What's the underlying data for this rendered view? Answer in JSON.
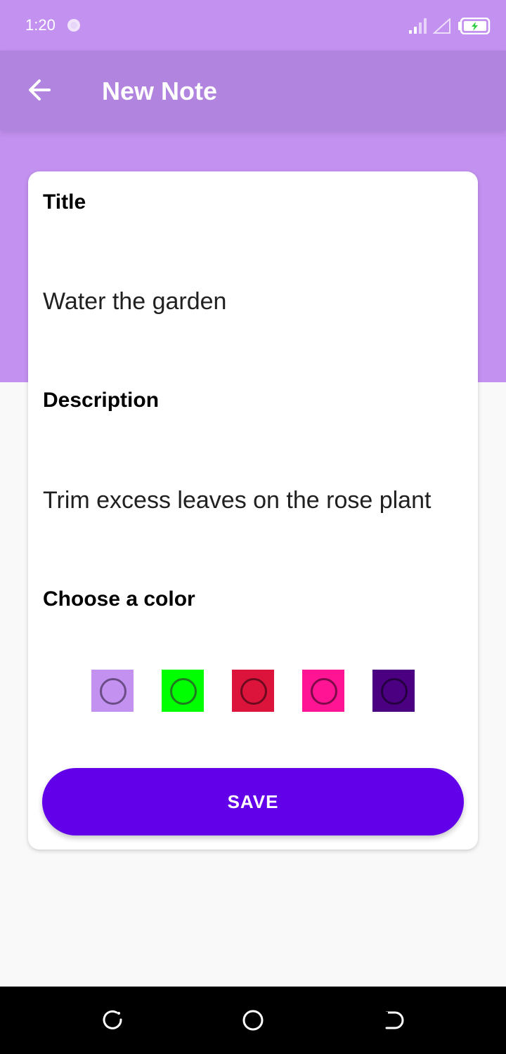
{
  "status_bar": {
    "time": "1:20",
    "icons": [
      "brightness-icon",
      "signal-icon",
      "no-sim-icon",
      "battery-charging-icon"
    ]
  },
  "app_bar": {
    "title": "New Note",
    "back_icon": "arrow-back-icon",
    "background": "#b084df"
  },
  "header_background": "#c391f0",
  "form": {
    "title_label": "Title",
    "title_value": "Water the garden",
    "description_label": "Description",
    "description_value": "Trim excess leaves on the rose plant",
    "color_label": "Choose a color",
    "colors": [
      {
        "name": "light-purple",
        "hex": "#c391f0",
        "ring": "#6b4d86"
      },
      {
        "name": "green",
        "hex": "#00ff00",
        "ring": "#1f7a1f"
      },
      {
        "name": "crimson",
        "hex": "#dc143c",
        "ring": "#6e0a1e"
      },
      {
        "name": "deep-pink",
        "hex": "#ff1493",
        "ring": "#7f0a49"
      },
      {
        "name": "indigo",
        "hex": "#4b0082",
        "ring": "#250041"
      }
    ],
    "save_label": "SAVE",
    "save_color": "#6200ea"
  },
  "nav_bar": {
    "buttons": [
      "recent-apps-icon",
      "home-icon",
      "back-icon"
    ]
  }
}
